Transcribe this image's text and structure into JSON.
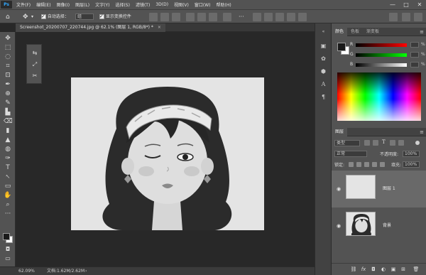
{
  "app": {
    "logo": "Ps",
    "brand_color": "#31a8ff"
  },
  "menu": [
    "文件(F)",
    "编辑(E)",
    "图像(I)",
    "图层(L)",
    "文字(Y)",
    "选择(S)",
    "滤镜(T)",
    "3D(D)",
    "视图(V)",
    "窗口(W)",
    "帮助(H)"
  ],
  "window_controls": {
    "minimize": "—",
    "maximize": "□",
    "close": "✕"
  },
  "options": {
    "auto_select_label": "自动选择：",
    "auto_select_value": "组",
    "show_transform_label": "显示变换控件",
    "more": "···"
  },
  "document": {
    "tab_title": "Screenshot_20200707_220744.jpg @ 62.1% (图层 1, RGB/8*) *",
    "tab_close": "×"
  },
  "status": {
    "zoom": "62.09%",
    "doc_info": "文档:1.62M/2.62M",
    "arrow": "›"
  },
  "color_panel": {
    "tabs": [
      "颜色",
      "色板",
      "渐变板"
    ],
    "channels": [
      {
        "label": "R",
        "unit": "%"
      },
      {
        "label": "G",
        "unit": "%"
      },
      {
        "label": "B",
        "unit": "%"
      }
    ],
    "foreground": "#1a1a1a",
    "background": "#ffffff"
  },
  "layers_panel": {
    "tab": "图层",
    "filter_label": "类型",
    "blend_mode": "正常",
    "opacity_label": "不透明度:",
    "opacity_value": "100%",
    "lock_label": "锁定:",
    "fill_label": "填充:",
    "fill_value": "100%",
    "layers": [
      {
        "name": "图层 1",
        "selected": true,
        "visible": true
      },
      {
        "name": "背景",
        "selected": false,
        "visible": true
      }
    ]
  },
  "icons": {
    "home": "⌂",
    "move": "✥",
    "eye": "◉",
    "menu": "≡",
    "swap": "⇄",
    "mask": "◘",
    "tools": [
      "✥",
      "⬚",
      "◌",
      "⌗",
      "⊡",
      "✒",
      "⊕",
      "✎",
      "▙",
      "⌫",
      "▮",
      "▲",
      "◍",
      "✑",
      "T",
      "↖",
      "▭",
      "✋",
      "⌕",
      "···"
    ],
    "gap": [
      "▣",
      "✿",
      "⬢",
      "A",
      "¶"
    ],
    "minipanel": [
      "⇆",
      "⤢",
      "✂"
    ],
    "layer_footer": [
      "⛓",
      "fx",
      "◘",
      "◐",
      "▣",
      "⊞",
      "🗑"
    ]
  }
}
